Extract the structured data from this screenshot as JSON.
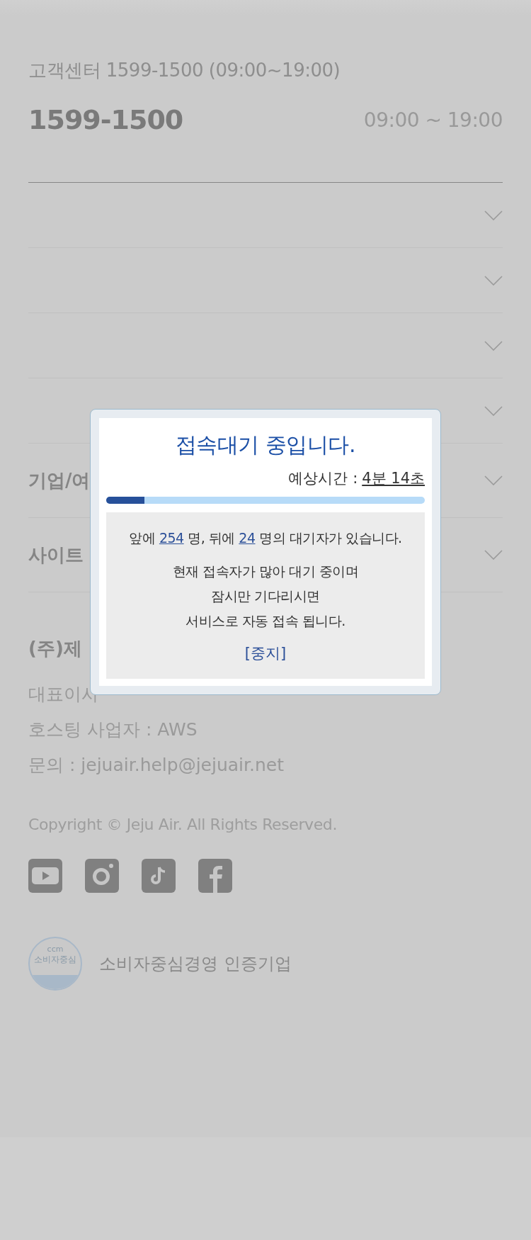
{
  "header": {
    "title": "고객센터 1599-1500 (09:00~19:00)",
    "phone": "1599-1500",
    "hours": "09:00 ~ 19:00"
  },
  "accordion": [
    {
      "expanded": false
    },
    {
      "expanded": false
    },
    {
      "expanded": false
    },
    {
      "expanded": false
    },
    {
      "label": "기업/여",
      "expanded": false
    },
    {
      "label": "사이트",
      "expanded": false
    }
  ],
  "company": {
    "name": "(주)제",
    "lines": [
      "대표이사",
      "호스팅 사업자 : AWS",
      "문의 : jejuair.help@jejuair.net"
    ]
  },
  "copyright": "Copyright © Jeju Air. All Rights Reserved.",
  "social": [
    {
      "kind": "youtube"
    },
    {
      "kind": "instagram"
    },
    {
      "kind": "tiktok"
    },
    {
      "kind": "facebook"
    }
  ],
  "certification": {
    "badge_top": "ccm",
    "badge_text": "소비자중심",
    "label": "소비자중심경영 인증기업"
  },
  "modal": {
    "title": "접속대기 중입니다.",
    "eta_label": "예상시간 :",
    "eta": "4분 14초",
    "progress": {
      "level": 0.12
    },
    "queue": {
      "before": "앞에",
      "ahead": "254",
      "middle": "명, 뒤에",
      "behind": "24",
      "after": "명의 대기자가 있습니다."
    },
    "message": [
      "현재 접속자가 많아 대기 중이며",
      "잠시만 기다리시면",
      "서비스로 자동 접속 됩니다."
    ],
    "stop": "[중지]"
  }
}
